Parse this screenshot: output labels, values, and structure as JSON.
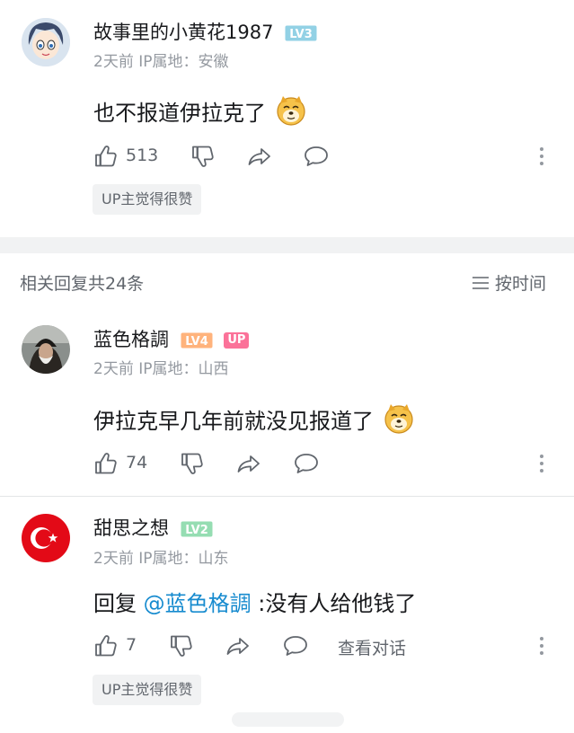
{
  "comment": {
    "username": "故事里的小黄花1987",
    "level": "LV3",
    "meta": "2天前 IP属地：安徽",
    "text": "也不报道伊拉克了",
    "likes": "513",
    "tag": "UP主觉得很赞"
  },
  "replies_header": {
    "title": "相关回复共24条",
    "sort_label": "按时间"
  },
  "replies": [
    {
      "username": "蓝色格調",
      "level": "LV4",
      "up_badge": "UP",
      "meta": "2天前 IP属地：山西",
      "text": "伊拉克早几年前就没见报道了",
      "likes": "74"
    },
    {
      "username": "甜思之想",
      "level": "LV2",
      "meta": "2天前 IP属地：山东",
      "text_prefix": "回复 ",
      "mention": "@蓝色格調",
      "text_suffix": " :没有人给他钱了",
      "likes": "7",
      "view_conversation": "查看对话",
      "tag": "UP主觉得很赞"
    }
  ],
  "colors": {
    "lv2": "#95ddb2",
    "lv3": "#92d1e5",
    "lv4": "#ffb37c",
    "up": "#fb7299",
    "mention": "#178bcf"
  }
}
